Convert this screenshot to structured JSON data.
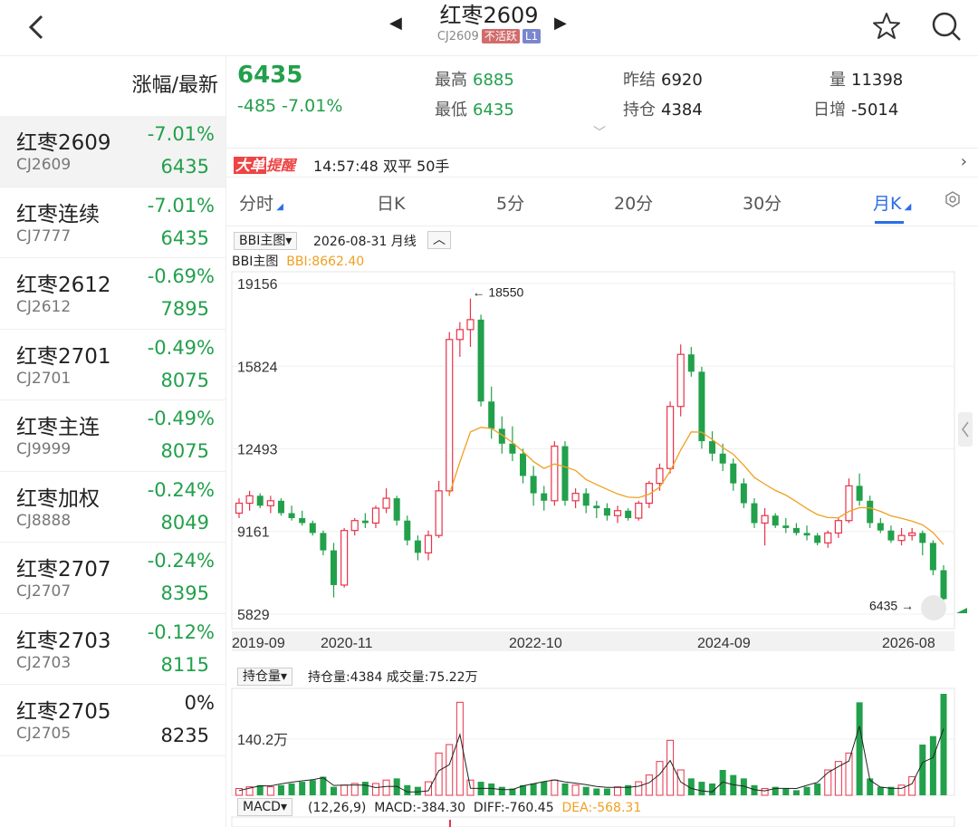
{
  "header": {
    "title": "红枣2609",
    "code": "CJ2609",
    "tag_inactive": "不活跃",
    "tag_level": "L1"
  },
  "watchlist": {
    "column_header": "涨幅/最新",
    "items": [
      {
        "name": "红枣2609",
        "code": "CJ2609",
        "pct": "-7.01%",
        "price": "6435"
      },
      {
        "name": "红枣连续",
        "code": "CJ7777",
        "pct": "-7.01%",
        "price": "6435"
      },
      {
        "name": "红枣2612",
        "code": "CJ2612",
        "pct": "-0.69%",
        "price": "7895"
      },
      {
        "name": "红枣2701",
        "code": "CJ2701",
        "pct": "-0.49%",
        "price": "8075"
      },
      {
        "name": "红枣主连",
        "code": "CJ9999",
        "pct": "-0.49%",
        "price": "8075"
      },
      {
        "name": "红枣加权",
        "code": "CJ8888",
        "pct": "-0.24%",
        "price": "8049"
      },
      {
        "name": "红枣2707",
        "code": "CJ2707",
        "pct": "-0.24%",
        "price": "8395"
      },
      {
        "name": "红枣2703",
        "code": "CJ2703",
        "pct": "-0.12%",
        "price": "8115"
      },
      {
        "name": "红枣2705",
        "code": "CJ2705",
        "pct": "0%",
        "price": "8235"
      }
    ]
  },
  "quote": {
    "last": "6435",
    "change": "-485 -7.01%",
    "high_label": "最高",
    "high": "6885",
    "low_label": "最低",
    "low": "6435",
    "prev_label": "昨结",
    "prev": "6920",
    "oi_label": "持仓",
    "oi": "4384",
    "vol_label": "量",
    "vol": "11398",
    "day_inc_label": "日增",
    "day_inc": "-5014"
  },
  "alert": {
    "logo_a": "大单",
    "logo_b": "提醒",
    "text": "14:57:48  双平  50手"
  },
  "tabs": [
    "分时",
    "日K",
    "5分",
    "20分",
    "30分",
    "月K"
  ],
  "main_chart": {
    "indicator_btn": "BBI主图▾",
    "date_label": "2026-08-31 月线",
    "legend_name": "BBI主图",
    "legend_value": "BBI:8662.40",
    "y_ticks": [
      "19156",
      "15824",
      "12493",
      "9161",
      "5829"
    ],
    "x_ticks": [
      "2019-09",
      "2020-11",
      "2022-10",
      "2024-09",
      "2026-08"
    ],
    "max_label": "18550",
    "min_label": "6435"
  },
  "vol_chart": {
    "indicator_btn": "持仓量▾",
    "info": "持仓量:4384  成交量:75.22万",
    "y_tick": "140.2万"
  },
  "macd": {
    "indicator_btn": "MACD▾",
    "params": "(12,26,9)",
    "macd": "MACD:-384.30",
    "diff": "DIFF:-760.45",
    "dea": "DEA:-568.31"
  },
  "colors": {
    "up": "#e8334a",
    "down": "#22a04b",
    "bbi": "#f0a020",
    "accent": "#2a6de8"
  },
  "chart_data": {
    "type": "candlestick",
    "period": "monthly",
    "y_range": [
      5829,
      19156
    ],
    "candles": [
      [
        9900,
        10500,
        9700,
        10300
      ],
      [
        10300,
        10800,
        10000,
        10600
      ],
      [
        10600,
        10700,
        10100,
        10200
      ],
      [
        10200,
        10600,
        9900,
        10400
      ],
      [
        10400,
        10500,
        9800,
        9900
      ],
      [
        9900,
        10200,
        9600,
        9700
      ],
      [
        9700,
        10000,
        9400,
        9500
      ],
      [
        9500,
        9600,
        9000,
        9100
      ],
      [
        9100,
        9200,
        8200,
        8400
      ],
      [
        8400,
        8700,
        6500,
        7000
      ],
      [
        7000,
        9300,
        6900,
        9200
      ],
      [
        9200,
        9700,
        9000,
        9600
      ],
      [
        9600,
        9900,
        9300,
        9500
      ],
      [
        9500,
        10200,
        9300,
        10100
      ],
      [
        10100,
        10900,
        9900,
        10500
      ],
      [
        10500,
        10600,
        9400,
        9600
      ],
      [
        9600,
        9800,
        8600,
        8800
      ],
      [
        8800,
        9000,
        8000,
        8300
      ],
      [
        8300,
        9200,
        8000,
        9000
      ],
      [
        9000,
        11200,
        8900,
        10800
      ],
      [
        10800,
        17200,
        10600,
        16900
      ],
      [
        16900,
        17600,
        16200,
        17300
      ],
      [
        17300,
        18550,
        16600,
        17700
      ],
      [
        17700,
        17900,
        14200,
        14400
      ],
      [
        14400,
        15000,
        12900,
        13300
      ],
      [
        13300,
        13800,
        12300,
        12700
      ],
      [
        12700,
        13400,
        12000,
        12300
      ],
      [
        12300,
        12500,
        11100,
        11400
      ],
      [
        11400,
        11800,
        10200,
        10700
      ],
      [
        10700,
        11000,
        10000,
        10400
      ],
      [
        10400,
        12800,
        10200,
        12600
      ],
      [
        12600,
        12800,
        10200,
        10400
      ],
      [
        10400,
        10900,
        10100,
        10700
      ],
      [
        10700,
        10900,
        9900,
        10200
      ],
      [
        10200,
        10400,
        9700,
        10100
      ],
      [
        10100,
        10300,
        9600,
        9800
      ],
      [
        9800,
        10200,
        9500,
        10000
      ],
      [
        10000,
        10100,
        9600,
        9700
      ],
      [
        9700,
        10400,
        9600,
        10300
      ],
      [
        10300,
        11200,
        10100,
        11100
      ],
      [
        11100,
        11900,
        10800,
        11700
      ],
      [
        11700,
        14400,
        11500,
        14200
      ],
      [
        14200,
        16700,
        13800,
        16300
      ],
      [
        16300,
        16600,
        15400,
        15600
      ],
      [
        15600,
        15800,
        12500,
        12800
      ],
      [
        12800,
        13200,
        12000,
        12300
      ],
      [
        12300,
        12700,
        11600,
        11900
      ],
      [
        11900,
        12100,
        10800,
        11100
      ],
      [
        11100,
        11300,
        10100,
        10300
      ],
      [
        10300,
        10500,
        9300,
        9500
      ],
      [
        9500,
        10100,
        8600,
        9800
      ],
      [
        9800,
        9900,
        9300,
        9400
      ],
      [
        9400,
        9700,
        9100,
        9300
      ],
      [
        9300,
        9500,
        9000,
        9100
      ],
      [
        9100,
        9400,
        8800,
        9000
      ],
      [
        9000,
        9100,
        8600,
        8700
      ],
      [
        8700,
        9200,
        8500,
        9100
      ],
      [
        9100,
        9700,
        8900,
        9600
      ],
      [
        9600,
        11300,
        9500,
        11000
      ],
      [
        11000,
        11500,
        10200,
        10400
      ],
      [
        10400,
        10600,
        9300,
        9500
      ],
      [
        9500,
        9700,
        9100,
        9200
      ],
      [
        9200,
        9400,
        8700,
        8800
      ],
      [
        8800,
        9300,
        8600,
        9000
      ],
      [
        9000,
        9300,
        8800,
        9100
      ],
      [
        9100,
        9200,
        8200,
        8700
      ],
      [
        8700,
        8800,
        7400,
        7600
      ],
      [
        7600,
        7800,
        6400,
        6435
      ]
    ]
  }
}
